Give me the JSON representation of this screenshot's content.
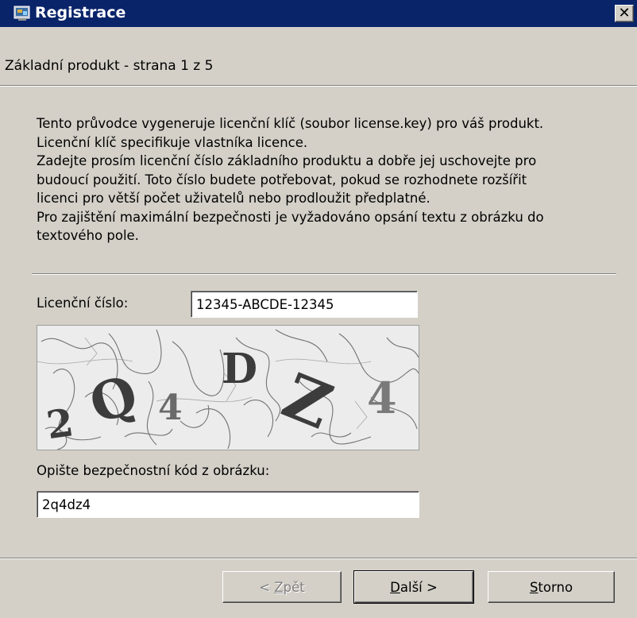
{
  "window": {
    "title": "Registrace",
    "close_glyph": "✕",
    "icon": "registration-app-icon"
  },
  "header": {
    "subtitle": "Základní produkt - strana 1 z 5"
  },
  "description": {
    "lines": [
      "Tento průvodce vygeneruje licenční klíč (soubor license.key) pro váš produkt.",
      "Licenční klíč specifikuje vlastníka licence.",
      "Zadejte prosím licenční číslo základního produktu a dobře jej uschovejte pro",
      "budoucí použití. Toto číslo budete potřebovat, pokud se rozhodnete rozšířit",
      "licenci pro větší počet uživatelů nebo prodloužit předplatné.",
      "Pro zajištění maximální bezpečnosti je vyžadováno opsání textu z obrázku do",
      "textového pole."
    ]
  },
  "license": {
    "label": "Licenční číslo:",
    "value": "12345-ABCDE-12345"
  },
  "captcha": {
    "characters": [
      "2",
      "Q",
      "4",
      "D",
      "Z",
      "4"
    ]
  },
  "code": {
    "label": "Opište bezpečnostní kód z obrázku:",
    "value": "2q4dz4"
  },
  "buttons": {
    "back": {
      "prefix": "< ",
      "mnemonic": "Z",
      "rest": "pět",
      "enabled": false
    },
    "next": {
      "mnemonic": "D",
      "rest": "alší >",
      "enabled": true
    },
    "cancel": {
      "mnemonic": "S",
      "rest": "torno",
      "enabled": true
    }
  },
  "colors": {
    "titlebar": "#0a246a",
    "dialog": "#d4d0c8",
    "disabled_text": "#808080"
  }
}
